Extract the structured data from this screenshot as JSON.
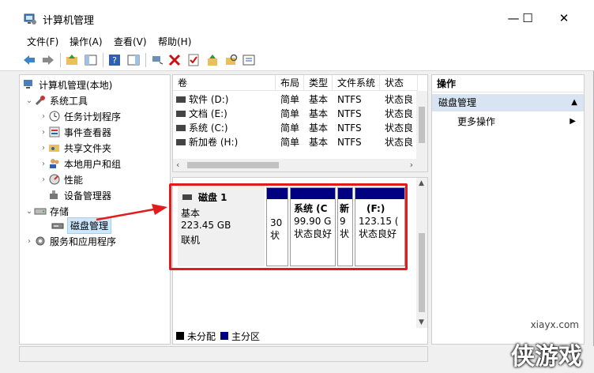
{
  "window": {
    "title": "计算机管理",
    "minimize": "—",
    "maximize": "☐",
    "close": "✕"
  },
  "menu": [
    "文件(F)",
    "操作(A)",
    "查看(V)",
    "帮助(H)"
  ],
  "tree": {
    "root": "计算机管理(本地)",
    "system_tools": "系统工具",
    "items": [
      "任务计划程序",
      "事件查看器",
      "共享文件夹",
      "本地用户和组",
      "性能",
      "设备管理器"
    ],
    "storage": "存储",
    "disk_mgmt": "磁盘管理",
    "services": "服务和应用程序"
  },
  "volumes": {
    "headers": [
      "卷",
      "布局",
      "类型",
      "文件系统",
      "状态"
    ],
    "rows": [
      [
        "软件 (D:)",
        "简单",
        "基本",
        "NTFS",
        "状态良"
      ],
      [
        "文档 (E:)",
        "简单",
        "基本",
        "NTFS",
        "状态良"
      ],
      [
        "系统 (C:)",
        "简单",
        "基本",
        "NTFS",
        "状态良"
      ],
      [
        "新加卷 (H:)",
        "简单",
        "基本",
        "NTFS",
        "状态良"
      ]
    ]
  },
  "disk": {
    "name": "磁盘 1",
    "type": "基本",
    "size": "223.45 GB",
    "status": "联机",
    "partitions": [
      {
        "line1": "",
        "line2": "30",
        "line3": "状"
      },
      {
        "line1": "系统 (C",
        "line2": "99.90 G",
        "line3": "状态良好"
      },
      {
        "line1": "",
        "line2": "9",
        "line3": "状"
      },
      {
        "line1": "(F:)",
        "line2": "123.15 (",
        "line3": "状态良好"
      }
    ],
    "partitions_small_top": "新"
  },
  "legend": {
    "unallocated": "未分配",
    "primary": "主分区"
  },
  "actions": {
    "header": "操作",
    "selected": "磁盘管理",
    "more": "更多操作"
  },
  "watermark": {
    "site": "xiayx.com",
    "brand": "侠游戏"
  },
  "colors": {
    "primary_partition": "#000080",
    "highlight": "#e01c1c"
  }
}
